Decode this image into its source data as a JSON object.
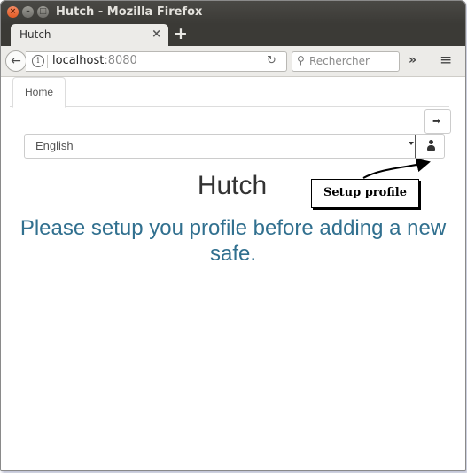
{
  "window": {
    "title": "Hutch - Mozilla Firefox",
    "close_glyph": "×",
    "min_glyph": "–",
    "max_glyph": "□"
  },
  "browser": {
    "tab_title": "Hutch",
    "tab_close_glyph": "×",
    "new_tab_glyph": "+",
    "back_glyph": "←",
    "info_glyph": "i",
    "url_host": "localhost",
    "url_port": ":8080",
    "reload_glyph": "↻",
    "search_glyph": "⚲",
    "search_placeholder": "Rechercher",
    "overflow_glyph": "»",
    "menu_glyph": "≡"
  },
  "app": {
    "nav_tab": "Home",
    "logout_glyph": "➡",
    "language": "English",
    "title": "Hutch",
    "message": "Please setup you profile before adding a new safe."
  },
  "annotation": {
    "callout_text": "Setup profile"
  }
}
